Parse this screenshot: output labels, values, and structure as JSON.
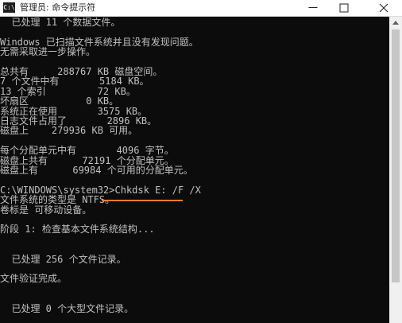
{
  "window": {
    "title": "管理员: 命令提示符",
    "icon_text": "C:\\"
  },
  "window_controls": {
    "minimize": "minimize-icon",
    "maximize": "maximize-icon",
    "close": "close-icon"
  },
  "console": {
    "lines": [
      "  已处理 11 个数据文件。",
      "",
      "Windows 已扫描文件系统并且没有发现问题。",
      "无需采取进一步操作。",
      "",
      "总共有     288767 KB 磁盘空间。",
      "7 个文件中有       5184 KB。",
      "13 个索引         72 KB。",
      "坏扇区          0 KB。",
      "系统正在使用       3575 KB。",
      "日志文件占用了       2896 KB。",
      "磁盘上    279936 KB 可用。",
      "",
      "每个分配单元中有       4096 字节。",
      "磁盘上共有      72191 个分配单元。",
      "磁盘上有      69984 个可用的分配单元。",
      "",
      "C:\\WINDOWS\\system32>Chkdsk E: /F /X",
      "文件系统的类型是 NTFS。",
      "卷标是 可移动设备。",
      "",
      "阶段 1: 检查基本文件系统结构...",
      "",
      "",
      "  已处理 256 个文件记录。",
      "",
      "文件验证完成。",
      "",
      "",
      "  已处理 0 个大型文件记录。"
    ],
    "highlight_color": "#e87e2a"
  }
}
